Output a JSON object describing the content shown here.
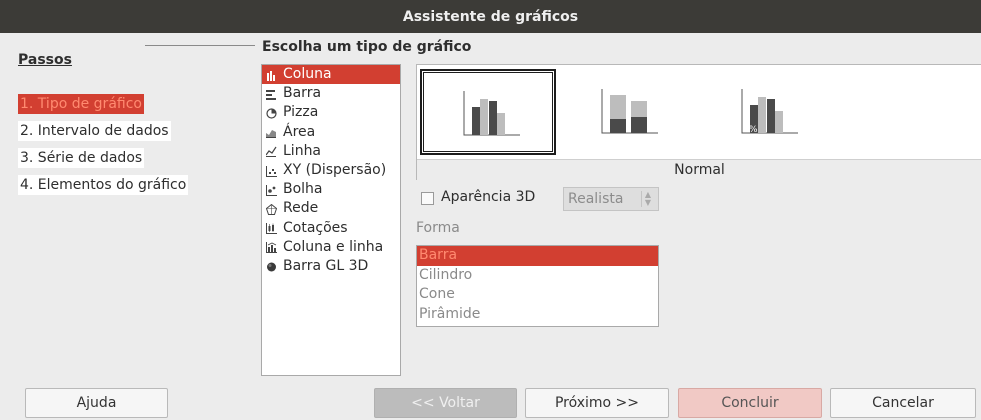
{
  "window": {
    "title": "Assistente de gráficos"
  },
  "sidebar": {
    "heading": "Passos",
    "steps": [
      {
        "label": "1. Tipo de gráfico",
        "active": true
      },
      {
        "label": "2. Intervalo de dados",
        "active": false
      },
      {
        "label": "3. Série de dados",
        "active": false
      },
      {
        "label": "4. Elementos do gráfico",
        "active": false
      }
    ]
  },
  "main": {
    "section_title": "Escolha um tipo de gráfico",
    "chart_types": [
      {
        "label": "Coluna",
        "icon": "column-chart-icon",
        "selected": true
      },
      {
        "label": "Barra",
        "icon": "bar-chart-icon"
      },
      {
        "label": "Pizza",
        "icon": "pie-chart-icon"
      },
      {
        "label": "Área",
        "icon": "area-chart-icon"
      },
      {
        "label": "Linha",
        "icon": "line-chart-icon"
      },
      {
        "label": "XY (Dispersão)",
        "icon": "scatter-chart-icon"
      },
      {
        "label": "Bolha",
        "icon": "bubble-chart-icon"
      },
      {
        "label": "Rede",
        "icon": "net-chart-icon"
      },
      {
        "label": "Cotações",
        "icon": "stock-chart-icon"
      },
      {
        "label": "Coluna e linha",
        "icon": "column-line-chart-icon"
      },
      {
        "label": "Barra GL 3D",
        "icon": "gl3d-bar-chart-icon"
      }
    ],
    "variants": [
      {
        "icon": "normal-column-icon",
        "selected": true
      },
      {
        "icon": "stacked-column-icon",
        "selected": false
      },
      {
        "icon": "percent-stacked-column-icon",
        "selected": false
      }
    ],
    "variant_label": "Normal",
    "appearance_3d": {
      "label": "Aparência 3D",
      "checked": false
    },
    "appearance_combo": {
      "value": "Realista"
    },
    "shape": {
      "label": "Forma",
      "options": [
        {
          "label": "Barra",
          "selected": true
        },
        {
          "label": "Cilindro"
        },
        {
          "label": "Cone"
        },
        {
          "label": "Pirâmide"
        }
      ]
    }
  },
  "buttons": {
    "help": "Ajuda",
    "back": "<< Voltar",
    "next": "Próximo >>",
    "finish": "Concluir",
    "cancel": "Cancelar"
  },
  "colors": {
    "accent": "#d23f31",
    "titlebar": "#3c3b37"
  }
}
